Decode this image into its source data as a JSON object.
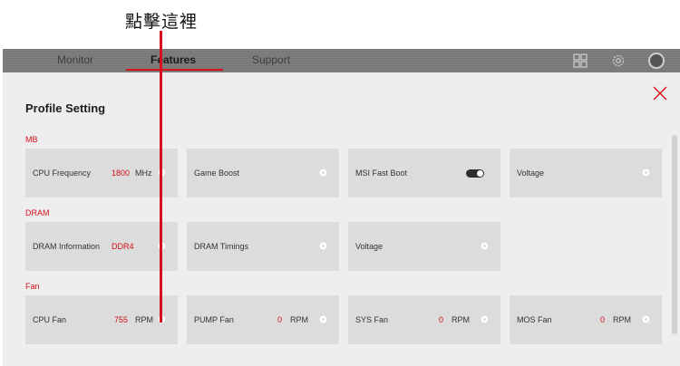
{
  "annotation": {
    "text": "點擊這裡"
  },
  "nav": {
    "tabs": [
      {
        "label": "Monitor"
      },
      {
        "label": "Features"
      },
      {
        "label": "Support"
      }
    ],
    "active_tab": "Features"
  },
  "icons": {
    "grid": "grid-icon",
    "settings": "gear-icon",
    "user": "avatar-icon",
    "close": "close-icon"
  },
  "panel": {
    "title": "Profile Setting"
  },
  "sections": {
    "mb": {
      "label": "MB",
      "cards": {
        "cpu_frequency": {
          "label": "CPU Frequency",
          "value": "1800",
          "unit": "MHz"
        },
        "game_boost": {
          "label": "Game Boost"
        },
        "msi_fast_boot": {
          "label": "MSI Fast Boot",
          "toggle": "on"
        },
        "voltage": {
          "label": "Voltage"
        }
      }
    },
    "dram": {
      "label": "DRAM",
      "cards": {
        "dram_information": {
          "label": "DRAM Information",
          "value": "DDR4"
        },
        "dram_timings": {
          "label": "DRAM Timings"
        },
        "voltage": {
          "label": "Voltage"
        }
      }
    },
    "fan": {
      "label": "Fan",
      "cards": {
        "cpu_fan": {
          "label": "CPU Fan",
          "value": "755",
          "unit": "RPM"
        },
        "pump_fan": {
          "label": "PUMP Fan",
          "value": "0",
          "unit": "RPM"
        },
        "sys_fan": {
          "label": "SYS Fan",
          "value": "0",
          "unit": "RPM"
        },
        "mos_fan": {
          "label": "MOS Fan",
          "value": "0",
          "unit": "RPM"
        }
      }
    }
  },
  "colors": {
    "accent": "#d4111c",
    "card_bg": "#dcdcdc",
    "panel_bg": "#eeeeee",
    "topbar_bg": "#7a7a7a"
  }
}
